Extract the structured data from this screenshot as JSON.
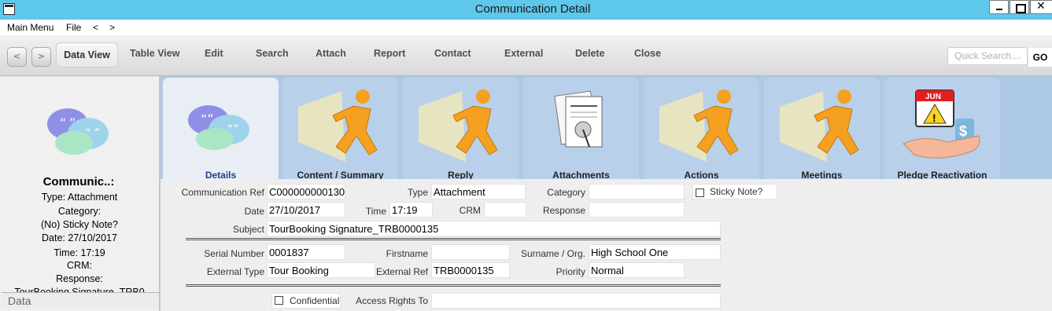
{
  "window": {
    "title": "Communication Detail"
  },
  "menu": {
    "main": "Main Menu",
    "file": "File",
    "back": "<",
    "forward": ">"
  },
  "toolbar": {
    "nav_back": "<",
    "nav_forward": ">",
    "data_view": "Data View",
    "table_view": "Table View",
    "edit": "Edit",
    "search": "Search",
    "attach": "Attach",
    "report": "Report",
    "contact": "Contact",
    "external": "External",
    "delete": "Delete",
    "close": "Close",
    "quick_search_placeholder": "Quick Search....",
    "go": "GO"
  },
  "left_panel": {
    "title": "Communic..:",
    "lines": [
      "Type: Attachment",
      "Category:",
      "(No) Sticky Note?",
      "Date: 27/10/2017",
      "Time: 17:19",
      "CRM:",
      "Response:",
      "TourBooking Signature_TRB0"
    ],
    "footer": "Data"
  },
  "tabs": [
    {
      "label": "Details",
      "icon": "speech-bubbles-icon"
    },
    {
      "label": "Content / Summary",
      "icon": "running-man-icon"
    },
    {
      "label": "Reply",
      "icon": "running-man-icon"
    },
    {
      "label": "Attachments",
      "icon": "pinned-documents-icon"
    },
    {
      "label": "Actions",
      "icon": "running-man-icon"
    },
    {
      "label": "Meetings",
      "icon": "running-man-icon"
    },
    {
      "label": "Pledge Reactivation",
      "icon": "calendar-warning-hand-icon",
      "calendar_month": "JUN"
    }
  ],
  "form": {
    "communication_ref_label": "Communication Ref",
    "communication_ref": "C000000000130",
    "type_label": "Type",
    "type": "Attachment",
    "category_label": "Category",
    "category": "",
    "sticky_label": "Sticky Note?",
    "date_label": "Date",
    "date": "27/10/2017",
    "time_label": "Time",
    "time": "17:19",
    "crm_label": "CRM",
    "crm": "",
    "response_label": "Response",
    "response": "",
    "subject_label": "Subject",
    "subject": "TourBooking Signature_TRB0000135",
    "serial_label": "Serial Number",
    "serial": "0001837",
    "firstname_label": "Firstname",
    "firstname": "",
    "surname_label": "Surname / Org.",
    "surname": "High School One",
    "ext_type_label": "External Type",
    "ext_type": "Tour Booking",
    "ext_ref_label": "External Ref",
    "ext_ref": "TRB0000135",
    "priority_label": "Priority",
    "priority": "Normal",
    "confidential_label": "Confidential",
    "access_label": "Access Rights To",
    "access": ""
  },
  "colors": {
    "titlebar": "#5ec8ea",
    "tabstrip": "#adc9e6",
    "active_tab_text": "#1e3d8c"
  }
}
